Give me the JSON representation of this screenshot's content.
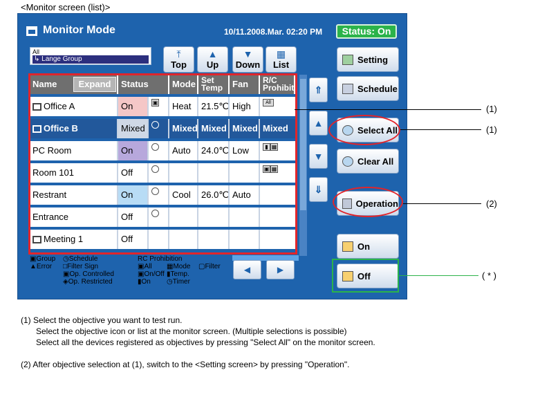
{
  "caption": "<Monitor screen (list)>",
  "header": {
    "title": "Monitor Mode",
    "datetime": "10/11.2008.Mar. 02:20 PM",
    "status": "Status: On"
  },
  "group_selector": {
    "all": "All",
    "selected": "↳ Lange Group"
  },
  "nav": {
    "top": "Top",
    "up": "Up",
    "down": "Down",
    "list": "List"
  },
  "side": {
    "setting": "Setting",
    "schedule": "Schedule",
    "select_all": "Select All",
    "clear_all": "Clear All",
    "operation": "Operation",
    "on": "On",
    "off": "Off"
  },
  "table": {
    "headers": {
      "name": "Name",
      "expand": "Expand",
      "status": "Status",
      "mode": "Mode",
      "set_temp_1": "Set",
      "set_temp_2": "Temp",
      "fan": "Fan",
      "prohibit_1": "R/C",
      "prohibit_2": "Prohibit"
    },
    "rows": [
      {
        "name": "Office A",
        "status": "On",
        "mode": "Heat",
        "temp": "21.5℃",
        "fan": "High",
        "prohibit": "All"
      },
      {
        "name": "Office B",
        "status": "Mixed",
        "mode": "Mixed",
        "temp": "Mixed",
        "fan": "Mixed",
        "prohibit": "Mixed"
      },
      {
        "name": "PC Room",
        "status": "On",
        "mode": "Auto",
        "temp": "24.0℃",
        "fan": "Low",
        "prohibit": ""
      },
      {
        "name": "Room 101",
        "status": "Off",
        "mode": "",
        "temp": "",
        "fan": "",
        "prohibit": ""
      },
      {
        "name": "Restrant",
        "status": "On",
        "mode": "Cool",
        "temp": "26.0℃",
        "fan": "Auto",
        "prohibit": ""
      },
      {
        "name": "Entrance",
        "status": "Off",
        "mode": "",
        "temp": "",
        "fan": "",
        "prohibit": ""
      },
      {
        "name": "Meeting 1",
        "status": "Off",
        "mode": "",
        "temp": "",
        "fan": "",
        "prohibit": ""
      }
    ]
  },
  "legend": {
    "group": "Group",
    "error": "Error",
    "schedule": "Schedule",
    "filter_sign": "Filter Sign",
    "op_controlled": "Op. Controlled",
    "op_restricted": "Op. Restricted",
    "rc_prohibition": "RC Prohibition",
    "all": "All",
    "mode": "Mode",
    "filter": "Filter",
    "onoff": "On/Off",
    "temp": "Temp.",
    "on": "On",
    "timer": "Timer"
  },
  "callouts": {
    "c1a": "(1)",
    "c1b": "(1)",
    "c2": "(2)",
    "cstar": "( * )"
  },
  "notes": [
    "(1) Select the objective you want to test run.",
    "Select the objective icon or list at the monitor screen. (Multiple selections is possible)",
    "Select all the devices registered as objectives by pressing \"Select All\" on the monitor screen.",
    "(2) After objective selection at (1), switch to the <Setting screen> by pressing \"Operation\"."
  ]
}
